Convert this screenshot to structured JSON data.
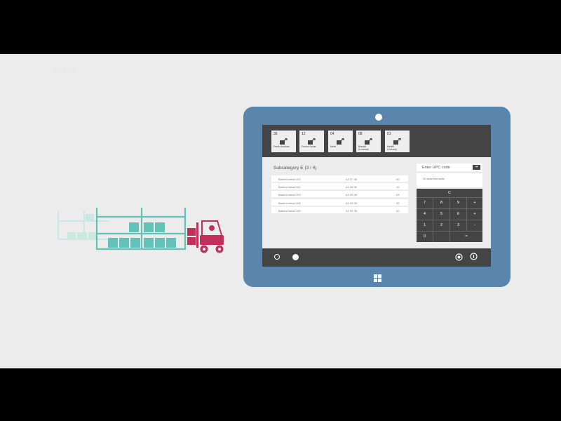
{
  "scene": {
    "ghost_label": "SCENE"
  },
  "tablet": {
    "categories": [
      {
        "count": "36",
        "name": "Fresh produce",
        "icon": "box-out-icon"
      },
      {
        "count": "12",
        "name": "Frozen foods",
        "icon": "box-out-icon"
      },
      {
        "count": "04",
        "name": "Meat",
        "icon": "box-out-icon"
      },
      {
        "count": "08",
        "name": "Breads\n& cereals",
        "icon": "box-out-icon"
      },
      {
        "count": "01",
        "name": "Health\n& beauty",
        "icon": "box-out-icon"
      }
    ],
    "subcategory_title": "Subcategory  E (3 / 4)",
    "rows": [
      {
        "name": "Bakers bread 101",
        "location": "A1  07  45",
        "qty": "00"
      },
      {
        "name": "Bakers bread 102",
        "location": "A1  08  50",
        "qty": "10"
      },
      {
        "name": "Bakers bread 103",
        "location": "A1  05  25",
        "qty": "03"
      },
      {
        "name": "Bakers bread 104",
        "location": "A1  03  25",
        "qty": "20"
      },
      {
        "name": "Bakers bread 105",
        "location": "A1  03  35",
        "qty": "00"
      }
    ],
    "upc": {
      "label": "Enter UPC code",
      "go_symbol": "➔",
      "scan_hint": "Or scan bar code"
    },
    "keypad": {
      "clear": "C",
      "keys": [
        "7",
        "8",
        "9",
        "+",
        "4",
        "5",
        "6",
        "+",
        "1",
        "2",
        "3",
        "-",
        "0",
        "",
        "=",
        ""
      ]
    },
    "colors": {
      "tablet_frame": "#5a86ad",
      "dark_bar": "#444444",
      "forklift": "#c0305a",
      "shelving": "#62c2b8"
    }
  }
}
